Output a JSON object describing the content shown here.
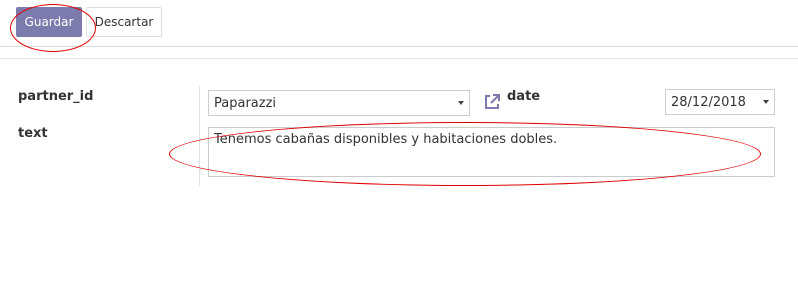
{
  "toolbar": {
    "save_label": "Guardar",
    "discard_label": "Descartar"
  },
  "form": {
    "partner_label": "partner_id",
    "partner_value": "Paparazzi",
    "date_label": "date",
    "date_value": "28/12/2018",
    "text_label": "text",
    "text_value": "Tenemos cabañas disponibles y habitaciones dobles."
  },
  "icons": {
    "external_link": "external-link-icon",
    "dropdown": "chevron-down-icon"
  },
  "colors": {
    "primary": "#7c7bad",
    "annotation": "#e00000",
    "icon": "#7c7bad"
  }
}
